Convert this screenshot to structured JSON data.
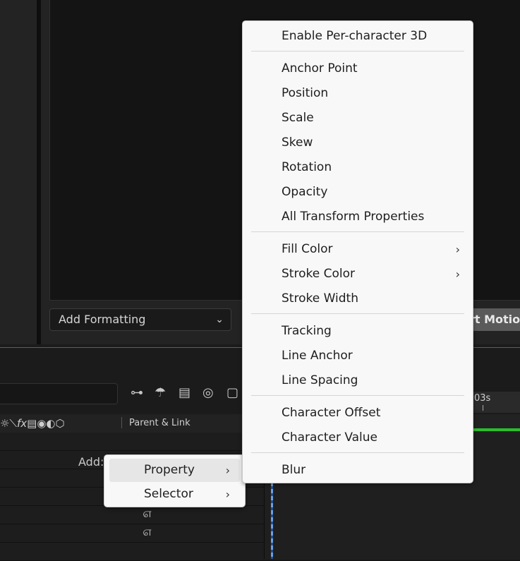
{
  "upper": {
    "add_formatting_label": "Add Formatting",
    "export_button_label": "ort Motion"
  },
  "timeline": {
    "time_label": "03s",
    "parent_link_header": "Parent & Link",
    "add_label": "Add:",
    "toolbar_icons": [
      "flowchart-icon",
      "shy-umbrella-icon",
      "frame-blend-icon",
      "motion-blur-icon",
      "graph-editor-icon"
    ],
    "column_icons": [
      "solo-sun-icon",
      "quality-slash-icon",
      "fx-icon",
      "frame-blending-icon",
      "motion-blur-icon",
      "adjustment-layer-icon",
      "3d-layer-icon"
    ]
  },
  "context_menu": {
    "groups": [
      {
        "items": [
          {
            "label": "Enable Per-character 3D",
            "has_submenu": false
          }
        ]
      },
      {
        "items": [
          {
            "label": "Anchor Point",
            "has_submenu": false
          },
          {
            "label": "Position",
            "has_submenu": false
          },
          {
            "label": "Scale",
            "has_submenu": false
          },
          {
            "label": "Skew",
            "has_submenu": false
          },
          {
            "label": "Rotation",
            "has_submenu": false
          },
          {
            "label": "Opacity",
            "has_submenu": false
          },
          {
            "label": "All Transform Properties",
            "has_submenu": false
          }
        ]
      },
      {
        "items": [
          {
            "label": "Fill Color",
            "has_submenu": true
          },
          {
            "label": "Stroke Color",
            "has_submenu": true
          },
          {
            "label": "Stroke Width",
            "has_submenu": false
          }
        ]
      },
      {
        "items": [
          {
            "label": "Tracking",
            "has_submenu": false
          },
          {
            "label": "Line Anchor",
            "has_submenu": false
          },
          {
            "label": "Line Spacing",
            "has_submenu": false
          }
        ]
      },
      {
        "items": [
          {
            "label": "Character Offset",
            "has_submenu": false
          },
          {
            "label": "Character Value",
            "has_submenu": false
          }
        ]
      },
      {
        "items": [
          {
            "label": "Blur",
            "has_submenu": false
          }
        ]
      }
    ]
  },
  "add_menu": {
    "items": [
      {
        "label": "Property",
        "has_submenu": true,
        "highlighted": true
      },
      {
        "label": "Selector",
        "has_submenu": true,
        "highlighted": false
      }
    ]
  },
  "colors": {
    "menu_bg": "#f8f8f8",
    "playhead": "#6aa0e6",
    "work_area_bar": "#2bbd2b",
    "panel_divider": "#3a62a8"
  }
}
